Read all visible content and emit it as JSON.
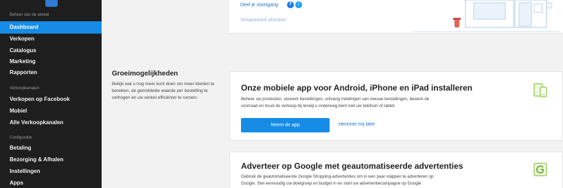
{
  "sidebar": {
    "sections": [
      {
        "title": "Beheer van de winkel",
        "items": [
          "Dashboard",
          "Verkopen",
          "Catalogus",
          "Marketing",
          "Rapporten"
        ]
      },
      {
        "title": "Verkoopkanalen",
        "items": [
          "Verkopen op Facebook",
          "Mobiel",
          "Alle Verkoopkanalen"
        ]
      },
      {
        "title": "Configuratie",
        "items": [
          "Betaling",
          "Bezorging & Afhalen",
          "Instellingen",
          "Apps"
        ]
      }
    ],
    "active_item": "Dashboard"
  },
  "top_card": {
    "share_label": "Deel je voortgang",
    "close_wizard": "Setupwizard afsluiten",
    "icons": [
      "facebook-icon",
      "twitter-icon"
    ]
  },
  "growth": {
    "title": "Groeimogelijkheden",
    "description": "Bekijk wat u nog meer kunt doen om meer klanten te bereiken, de gemiddelde waarde per bestelling te verhogen en uw winkel efficiënter te runnen."
  },
  "cards": {
    "mobile_app": {
      "title": "Onze mobiele app voor Android, iPhone en iPad installeren",
      "description": "Beheer uw producten, verwerk bestellingen, ontvang meldingen van nieuwe bestellingen, bewerk de voorraad en houd de verkoop bij terwijl u onderweg bent met uw telefoon of tablet.",
      "primary_label": "Neem de app",
      "secondary_label": "Herinner mij later",
      "icon": "mobile-devices-icon"
    },
    "google_ads": {
      "title": "Adverteer op Google met geautomatiseerde advertenties",
      "description": "Gebruik de geautomatiseerde Google Shopping-advertenties om in een paar stappen te adverteren op Google. Stel eenvoudig uw doelgroep en budget in en start uw advertentiecampagne op Google",
      "icon": "google-ads-icon"
    }
  },
  "colors": {
    "sidebar_bg": "#1e1e1e",
    "accent": "#168ce6",
    "link": "#1a73c8"
  }
}
